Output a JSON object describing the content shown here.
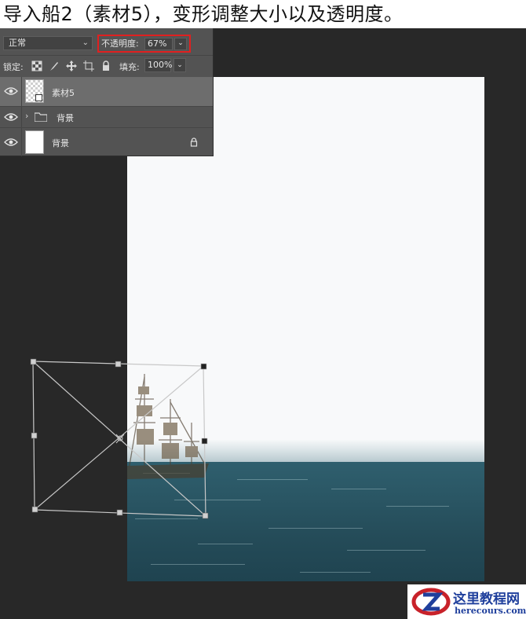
{
  "caption": "导入船2（素材5），变形调整大小以及透明度。",
  "colors": {
    "accent_red": "#e02020",
    "panel_bg": "#535353",
    "workspace_bg": "#282828"
  },
  "panel": {
    "blend_mode": "正常",
    "opacity_label": "不透明度:",
    "opacity_value": "67%",
    "lock_label": "锁定:",
    "lock_icons": [
      "lock-transparent-pixels-icon",
      "lock-image-pixels-icon",
      "lock-position-icon",
      "lock-artboard-icon",
      "lock-all-icon"
    ],
    "fill_label": "填充:",
    "fill_value": "100%",
    "layers": [
      {
        "name": "素材5",
        "type": "smart-object",
        "selected": true,
        "visible": true
      },
      {
        "name": "背景",
        "type": "group",
        "selected": false,
        "visible": true
      },
      {
        "name": "背景",
        "type": "locked-background",
        "selected": false,
        "visible": true
      }
    ]
  },
  "watermark": {
    "title": "这里教程网",
    "url": "herecours.com"
  }
}
